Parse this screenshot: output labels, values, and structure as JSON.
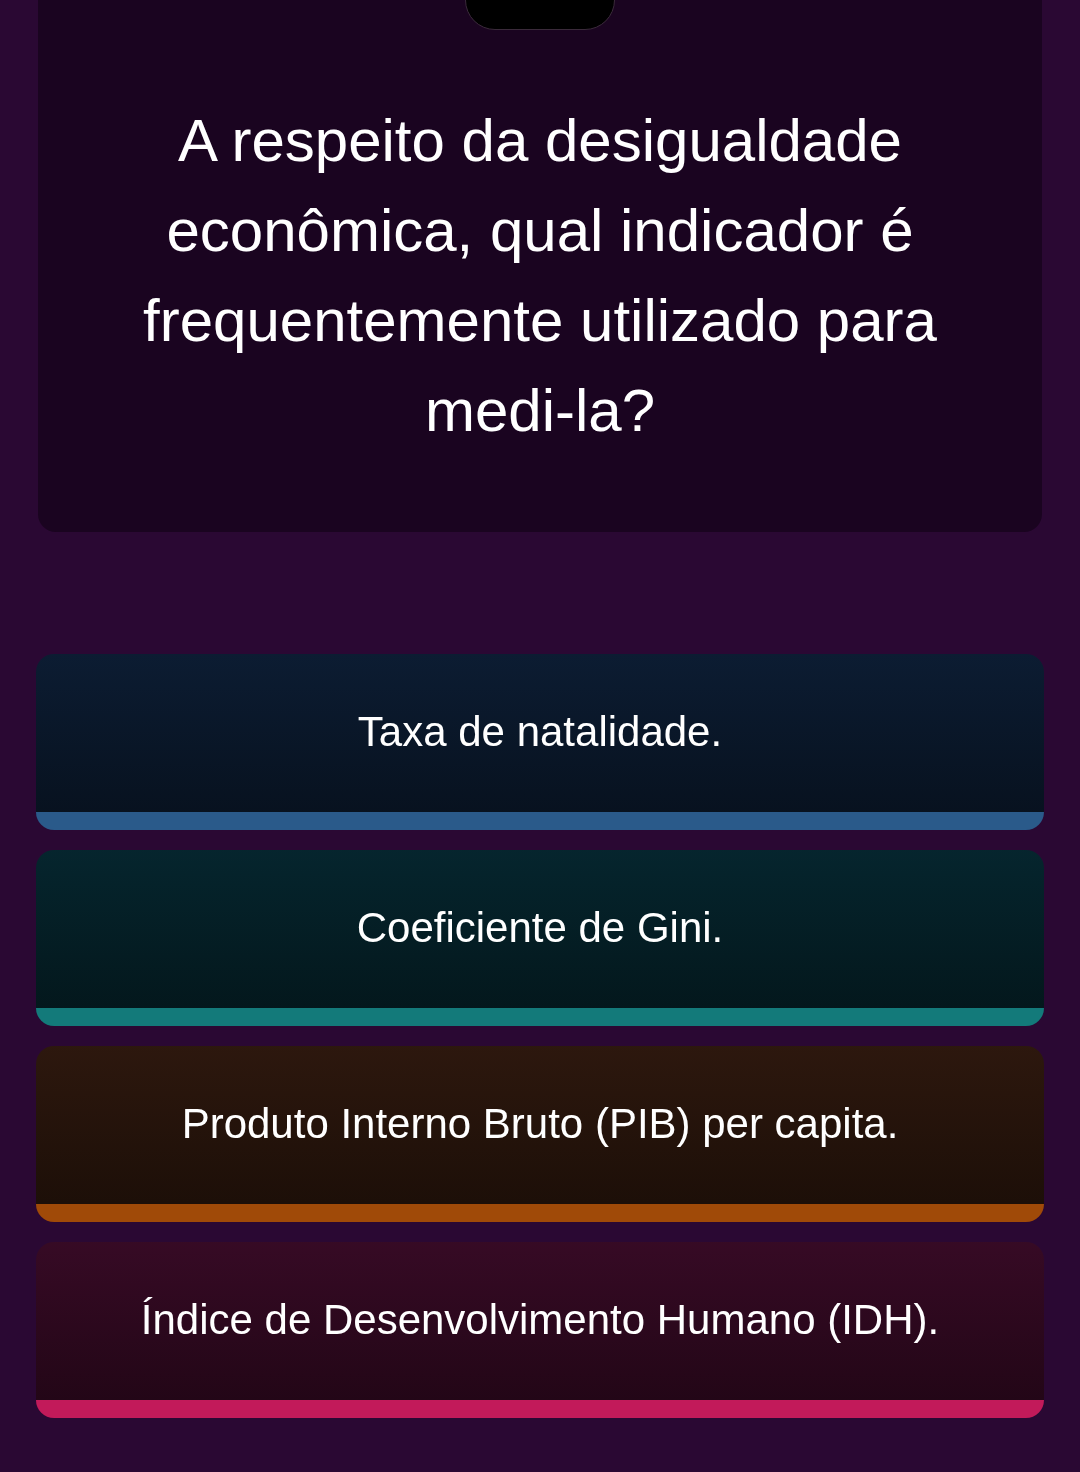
{
  "question": "A respeito da desigualdade econômica, qual indicador é frequentemente utilizado para medi-la?",
  "options": [
    {
      "label": "Taxa de natalidade.",
      "color": "#2a5a8a"
    },
    {
      "label": "Coeficiente de Gini.",
      "color": "#137a7a"
    },
    {
      "label": "Produto Interno Bruto (PIB) per capita.",
      "color": "#a04a08"
    },
    {
      "label": "Índice de Desenvolvimento Humano (IDH).",
      "color": "#c21a5a"
    }
  ]
}
